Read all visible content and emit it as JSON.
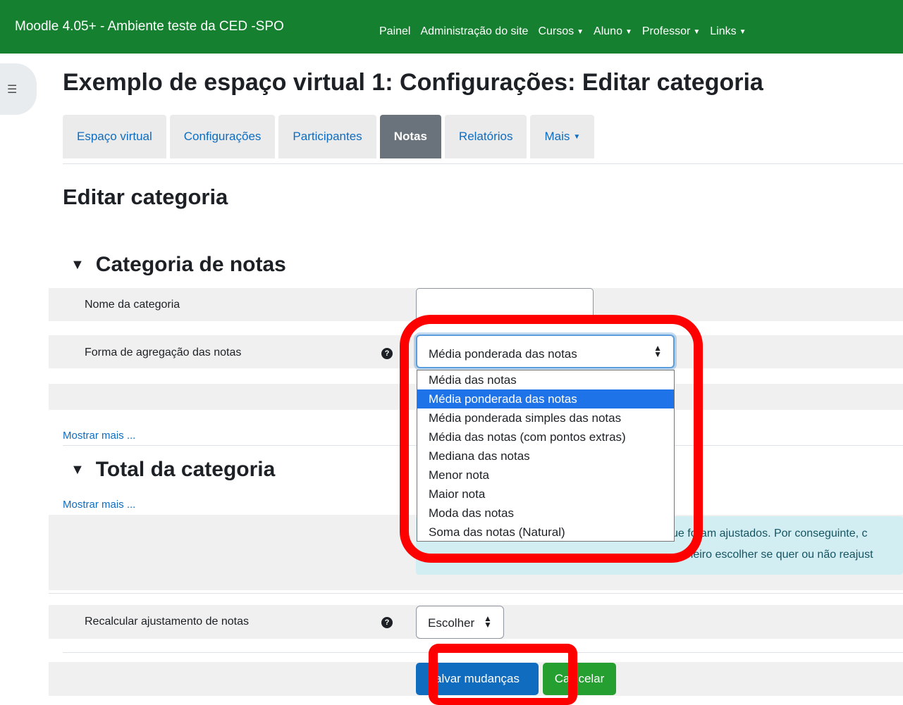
{
  "navbar": {
    "site_name": "Moodle 4.05+ - Ambiente teste da CED -SPO",
    "links": [
      {
        "label": "Painel",
        "has_caret": false
      },
      {
        "label": "Administração do site",
        "has_caret": false
      },
      {
        "label": "Cursos",
        "has_caret": true
      },
      {
        "label": "Aluno",
        "has_caret": true
      },
      {
        "label": "Professor",
        "has_caret": true
      },
      {
        "label": "Links",
        "has_caret": true
      }
    ],
    "color": "#15802f"
  },
  "page": {
    "title": "Exemplo de espaço virtual 1: Configurações: Editar categoria",
    "heading": "Editar categoria"
  },
  "tabs": [
    {
      "label": "Espaço virtual",
      "active": false
    },
    {
      "label": "Configurações",
      "active": false
    },
    {
      "label": "Participantes",
      "active": false
    },
    {
      "label": "Notas",
      "active": true
    },
    {
      "label": "Relatórios",
      "active": false
    },
    {
      "label": "Mais",
      "active": false
    }
  ],
  "section_grade": {
    "title": "Categoria de notas",
    "name_label": "Nome da categoria",
    "name_value": "",
    "aggregation_label": "Forma de agregação das notas",
    "aggregation_value": "Média ponderada das notas",
    "options": [
      "Média das notas",
      "Média ponderada das notas",
      "Média ponderada simples das notas",
      "Média das notas (com pontos extras)",
      "Mediana das notas",
      "Menor nota",
      "Maior nota",
      "Moda das notas",
      "Soma das notas (Natural)"
    ],
    "selected_option": "Média ponderada das notas",
    "show_more": "Mostrar mais ..."
  },
  "section_total": {
    "title": "Total da categoria",
    "show_more": "Mostrar mais ...",
    "info_line1": "ue foram ajustados. Por conseguinte, c",
    "info_line2": "meiro escolher se quer ou não reajust",
    "recalc_label": "Recalcular ajustamento de notas",
    "recalc_value": "Escolher"
  },
  "buttons": {
    "save": "alvar mudanças",
    "cancel_part1": "Ca",
    "cancel_part2": "celar"
  },
  "colors": {
    "link": "#0f6cbf",
    "primary": "#0f6cbf",
    "success": "#25a030",
    "highlight": "#ff0000"
  }
}
